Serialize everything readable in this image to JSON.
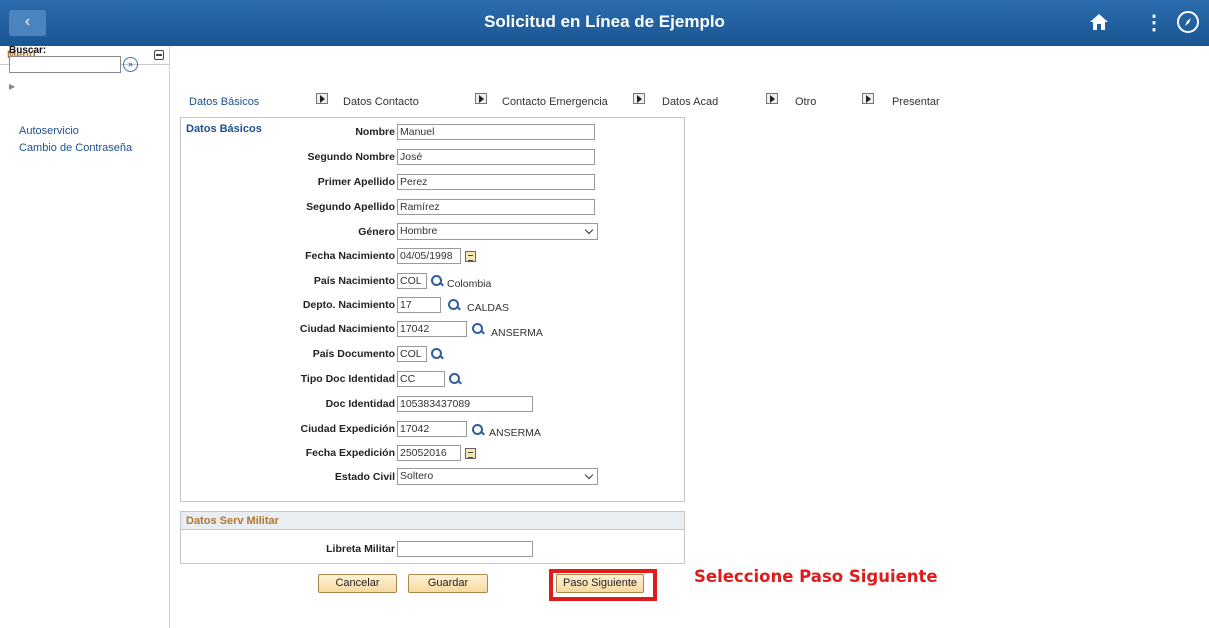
{
  "app": {
    "title": "Solicitud en Línea de Ejemplo"
  },
  "sidebar": {
    "title": "Menú",
    "search_label": "Buscar:",
    "search_value": "",
    "links": [
      "Autoservicio",
      "Cambio de Contraseña"
    ]
  },
  "tabs": [
    "Datos Básicos",
    "Datos Contacto",
    "Contacto Emergencia",
    "Datos Acad",
    "Otro",
    "Presentar"
  ],
  "form": {
    "section_title": "Datos Básicos",
    "labels": {
      "nombre": "Nombre",
      "segundo_nombre": "Segundo Nombre",
      "primer_apellido": "Primer Apellido",
      "segundo_apellido": "Segundo Apellido",
      "genero": "Género",
      "fecha_nacimiento": "Fecha Nacimiento",
      "pais_nacimiento": "País Nacimiento",
      "depto_nacimiento": "Depto. Nacimiento",
      "ciudad_nacimiento": "Ciudad Nacimiento",
      "pais_documento": "País Documento",
      "tipo_doc": "Tipo Doc Identidad",
      "doc_identidad": "Doc Identidad",
      "ciudad_expedicion": "Ciudad Expedición",
      "fecha_expedicion": "Fecha Expedición",
      "estado_civil": "Estado Civil"
    },
    "values": {
      "nombre": "Manuel",
      "segundo_nombre": "José",
      "primer_apellido": "Perez",
      "segundo_apellido": "Ramírez",
      "genero": "Hombre",
      "fecha_nacimiento": "04/05/1998",
      "pais_nacimiento": "COL",
      "pais_nacimiento_desc": "Colombia",
      "depto_nacimiento": "17",
      "depto_nacimiento_desc": "CALDAS",
      "ciudad_nacimiento": "17042",
      "ciudad_nacimiento_desc": "ANSERMA",
      "pais_documento": "COL",
      "tipo_doc": "CC",
      "doc_identidad": "105383437089",
      "ciudad_expedicion": "17042",
      "ciudad_expedicion_desc": "ANSERMA",
      "fecha_expedicion": "25052016",
      "estado_civil": "Soltero"
    }
  },
  "military": {
    "title": "Datos Serv Militar",
    "label": "Libreta Militar",
    "value": ""
  },
  "buttons": {
    "cancel": "Cancelar",
    "save": "Guardar",
    "next": "Paso Siguiente"
  },
  "annotation": "Seleccione Paso Siguiente",
  "colors": {
    "header": "#1f5c99",
    "accent_label": "#b2762b",
    "link": "#1d4f8f",
    "highlight": "#e01b1b"
  }
}
